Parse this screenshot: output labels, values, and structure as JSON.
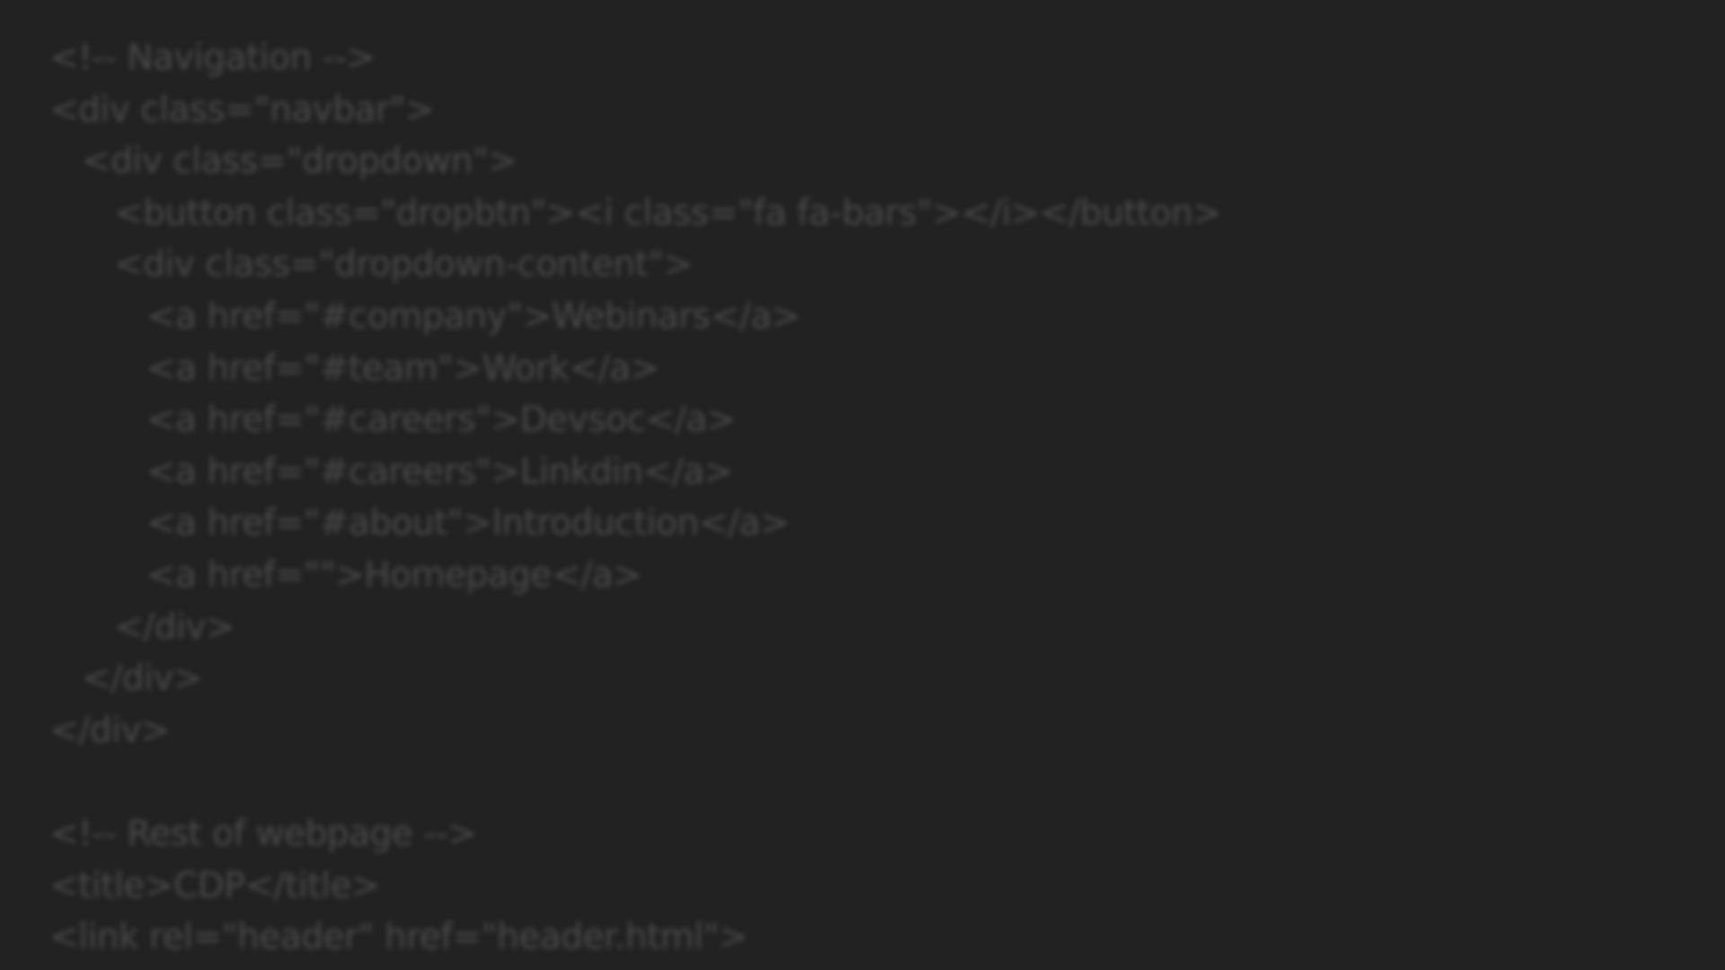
{
  "editor": {
    "background_color": "#222222",
    "text_color": "#4a4a4a",
    "lines": [
      {
        "text": "<!-- Navigation -->",
        "indent": 0
      },
      {
        "text": "<div class=\"navbar\">",
        "indent": 0
      },
      {
        "text": "<div class=\"dropdown\">",
        "indent": 1
      },
      {
        "text": "<button class=\"dropbtn\"><i class=\"fa fa-bars\"></i></button>",
        "indent": 2
      },
      {
        "text": "<div class=\"dropdown-content\">",
        "indent": 2
      },
      {
        "text": "<a href=\"#company\">Webinars</a>",
        "indent": 3
      },
      {
        "text": "<a href=\"#team\">Work</a>",
        "indent": 3
      },
      {
        "text": "<a href=\"#careers\">Devsoc</a>",
        "indent": 3
      },
      {
        "text": "<a href=\"#careers\">Linkdin</a>",
        "indent": 3
      },
      {
        "text": "<a href=\"#about\">Introduction</a>",
        "indent": 3
      },
      {
        "text": "<a href=\"\">Homepage</a>",
        "indent": 3
      },
      {
        "text": "</div>",
        "indent": 2
      },
      {
        "text": "</div>",
        "indent": 1
      },
      {
        "text": "</div>",
        "indent": 0
      },
      {
        "text": "",
        "indent": 0
      },
      {
        "text": "<!-- Rest of webpage -->",
        "indent": 0
      },
      {
        "text": "<title>CDP</title>",
        "indent": 0
      },
      {
        "text": "<link rel=\"header\" href=\"header.html\">",
        "indent": 0
      }
    ]
  }
}
